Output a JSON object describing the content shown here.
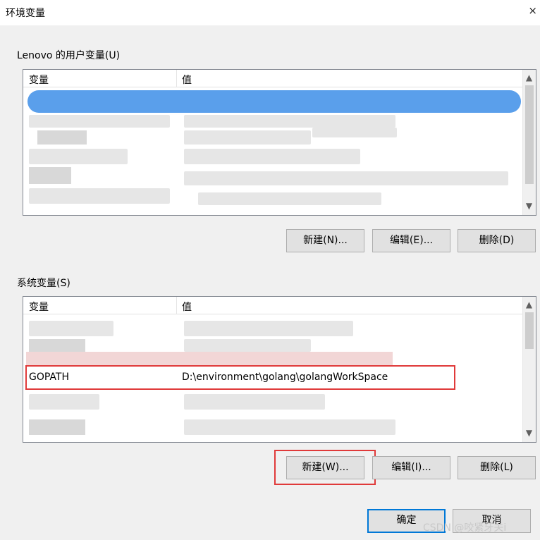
{
  "window": {
    "title": "环境变量",
    "close_icon": "×"
  },
  "user_section": {
    "label": "Lenovo 的用户变量(U)",
    "columns": [
      "变量",
      "值"
    ],
    "buttons": {
      "new": "新建(N)...",
      "edit": "编辑(E)...",
      "delete": "删除(D)"
    }
  },
  "system_section": {
    "label": "系统变量(S)",
    "columns": [
      "变量",
      "值"
    ],
    "visible_row": {
      "name": "GOPATH",
      "value": "D:\\environment\\golang\\golangWorkSpace"
    },
    "buttons": {
      "new": "新建(W)...",
      "edit": "编辑(I)...",
      "delete": "删除(L)"
    }
  },
  "footer": {
    "ok": "确定",
    "cancel": "取消"
  },
  "watermark": "CSDN @咬紧牙关i",
  "colors": {
    "accent": "#0078d7",
    "highlight": "#e03a3a",
    "selection": "#3d8ee8"
  }
}
